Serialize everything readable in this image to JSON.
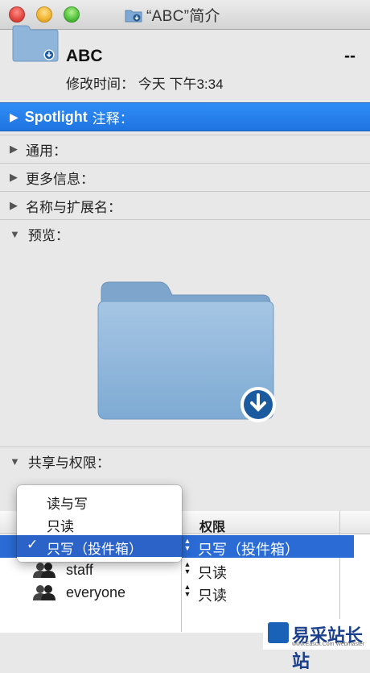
{
  "window": {
    "title": "“ABC”简介"
  },
  "header": {
    "name": "ABC",
    "size": "--",
    "modified": "修改时间：  今天 下午3:34"
  },
  "sections": {
    "spotlight_title": "Spotlight",
    "spotlight_suffix": "注释：",
    "general": "通用：",
    "more_info": "更多信息：",
    "name_ext": "名称与扩展名：",
    "preview": "预览：",
    "sharing": "共享与权限："
  },
  "permissions": {
    "column_privilege": "权限",
    "rows": [
      {
        "user": "",
        "privilege": "只写（投件箱）"
      },
      {
        "user": "staff",
        "privilege": "只读"
      },
      {
        "user": "everyone",
        "privilege": "只读"
      }
    ]
  },
  "menu": {
    "items": [
      "读与写",
      "只读",
      "只写（投件箱）"
    ],
    "selected_index": 2
  },
  "watermark": {
    "text": "易采站长站",
    "sub": "www.Easck.Com Webmaster"
  },
  "colors": {
    "selection": "#2a6bd6",
    "spotlight_bar": "#2f8df7",
    "folder": "#8fb8dd"
  }
}
